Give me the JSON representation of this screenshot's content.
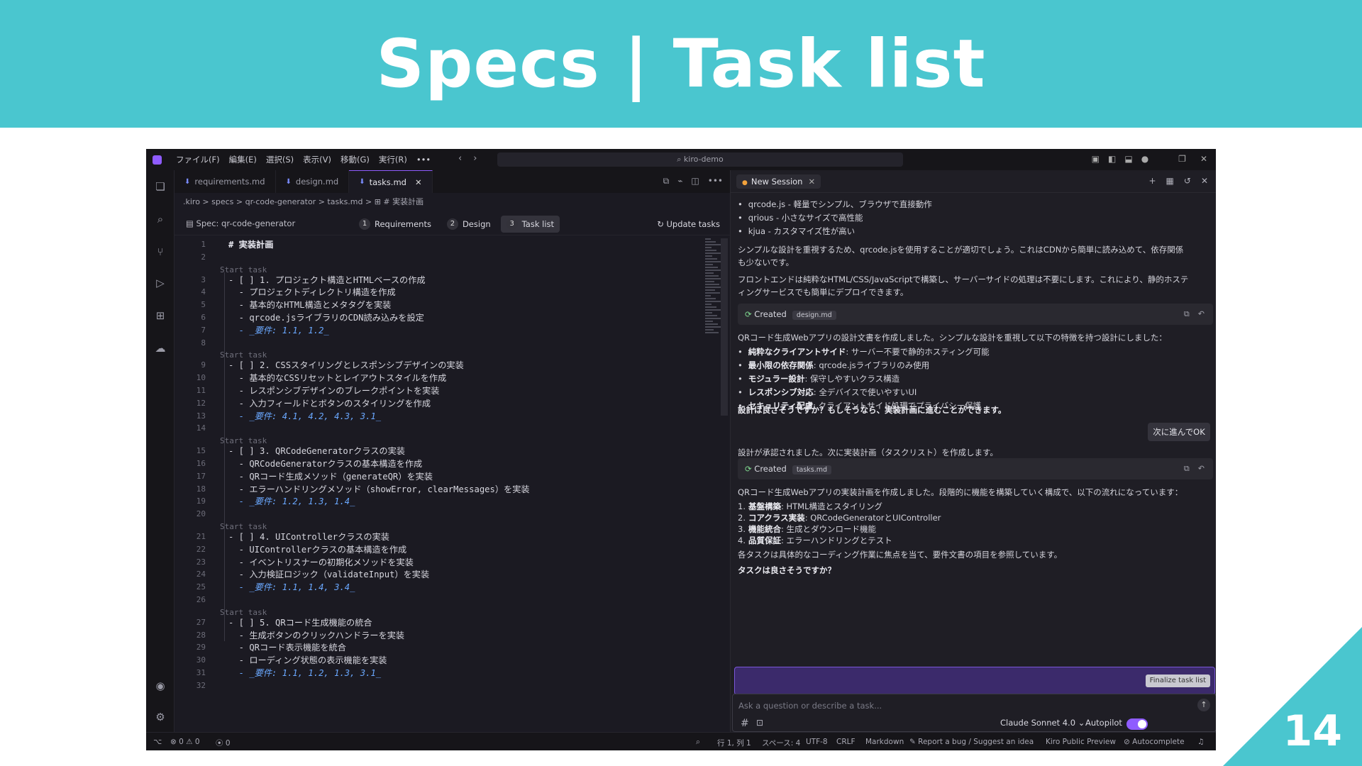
{
  "slide": {
    "title": "Specs | Task list",
    "page_number": "14",
    "accent_color": "#4ac6cf"
  },
  "titlebar": {
    "menu": [
      "ファイル(F)",
      "編集(E)",
      "選択(S)",
      "表示(V)",
      "移動(G)",
      "実行(R)",
      "•••"
    ],
    "search": "kiro-demo"
  },
  "tabs": [
    {
      "label": "requirements.md"
    },
    {
      "label": "design.md"
    },
    {
      "label": "tasks.md",
      "active": true
    }
  ],
  "breadcrumb": ".kiro > specs > qr-code-generator > tasks.md > ⊞ # 実装計画",
  "specbar": {
    "name": "Spec: qr-code-generator",
    "steps": [
      {
        "num": "1",
        "label": "Requirements"
      },
      {
        "num": "2",
        "label": "Design"
      },
      {
        "num": "3",
        "label": "Task list",
        "active": true
      }
    ],
    "update": "Update tasks"
  },
  "code": {
    "lens_label": "Start task",
    "lines": [
      {
        "n": "1",
        "t": "# 実装計画",
        "kind": "h1"
      },
      {
        "n": "2",
        "t": ""
      },
      {
        "n": "3",
        "t": "- [ ] 1. プロジェクト構造とHTMLベースの作成"
      },
      {
        "n": "4",
        "t": "  - プロジェクトディレクトリ構造を作成"
      },
      {
        "n": "5",
        "t": "  - 基本的なHTML構造とメタタグを実装"
      },
      {
        "n": "6",
        "t": "  - qrcode.jsライブラリのCDN読み込みを設定"
      },
      {
        "n": "7",
        "t": "  - _要件: 1.1, 1.2_",
        "kind": "req"
      },
      {
        "n": "8",
        "t": ""
      },
      {
        "n": "9",
        "t": "- [ ] 2. CSSスタイリングとレスポンシブデザインの実装"
      },
      {
        "n": "10",
        "t": "  - 基本的なCSSリセットとレイアウトスタイルを作成"
      },
      {
        "n": "11",
        "t": "  - レスポンシブデザインのブレークポイントを実装"
      },
      {
        "n": "12",
        "t": "  - 入力フィールドとボタンのスタイリングを作成"
      },
      {
        "n": "13",
        "t": "  - _要件: 4.1, 4.2, 4.3, 3.1_",
        "kind": "req"
      },
      {
        "n": "14",
        "t": ""
      },
      {
        "n": "15",
        "t": "- [ ] 3. QRCodeGeneratorクラスの実装"
      },
      {
        "n": "16",
        "t": "  - QRCodeGeneratorクラスの基本構造を作成"
      },
      {
        "n": "17",
        "t": "  - QRコード生成メソッド（generateQR）を実装"
      },
      {
        "n": "18",
        "t": "  - エラーハンドリングメソッド（showError, clearMessages）を実装"
      },
      {
        "n": "19",
        "t": "  - _要件: 1.2, 1.3, 1.4_",
        "kind": "req"
      },
      {
        "n": "20",
        "t": ""
      },
      {
        "n": "21",
        "t": "- [ ] 4. UIControllerクラスの実装"
      },
      {
        "n": "22",
        "t": "  - UIControllerクラスの基本構造を作成"
      },
      {
        "n": "23",
        "t": "  - イベントリスナーの初期化メソッドを実装"
      },
      {
        "n": "24",
        "t": "  - 入力検証ロジック（validateInput）を実装"
      },
      {
        "n": "25",
        "t": "  - _要件: 1.1, 1.4, 3.4_",
        "kind": "req"
      },
      {
        "n": "26",
        "t": ""
      },
      {
        "n": "27",
        "t": "- [ ] 5. QRコード生成機能の統合"
      },
      {
        "n": "28",
        "t": "  - 生成ボタンのクリックハンドラーを実装"
      },
      {
        "n": "29",
        "t": "  - QRコード表示機能を統合"
      },
      {
        "n": "30",
        "t": "  - ローディング状態の表示機能を実装"
      },
      {
        "n": "31",
        "t": "  - _要件: 1.1, 1.2, 1.3, 3.1_",
        "kind": "req"
      },
      {
        "n": "32",
        "t": ""
      }
    ]
  },
  "chat": {
    "session": "New Session",
    "lib_items": [
      "qrcode.js - 軽量でシンプル、ブラウザで直接動作",
      "qrious - 小さなサイズで高性能",
      "kjua - カスタマイズ性が高い"
    ],
    "para1_a": "シンプルな設計を重視するため、qrcode.jsを使用することが適切でしょう。これはCDNから簡単に読み込めて、依存関係",
    "para1_b": "も少ないです。",
    "para2_a": "フロントエンドは純粋なHTML/CSS/JavaScriptで構築し、サーバーサイドの処理は不要にします。これにより、静的ホステ",
    "para2_b": "ィングサービスでも簡単にデプロイできます。",
    "created_label": "Created",
    "created1_file": "design.md",
    "design_summary": "QRコード生成Webアプリの設計文書を作成しました。シンプルな設計を重視して以下の特徴を持つ設計にしました：",
    "design_features": [
      {
        "bold": "純粋なクライアントサイド",
        "rest": ": サーバー不要で静的ホスティング可能"
      },
      {
        "bold": "最小限の依存関係",
        "rest": ": qrcode.jsライブラリのみ使用"
      },
      {
        "bold": "モジュラー設計",
        "rest": ": 保守しやすいクラス構造"
      },
      {
        "bold": "レスポンシブ対応",
        "rest": ": 全デバイスで使いやすいUI"
      },
      {
        "bold": "セキュリティ配慮",
        "rest": ": クライアントサイド処理でプライバシー保護"
      }
    ],
    "design_question": "設計は良さそうですか？もしそうなら、実装計画に進むことができます。",
    "ok_button": "次に進んでOK",
    "approved": "設計が承認されました。次に実装計画（タスクリスト）を作成します。",
    "created2_file": "tasks.md",
    "tasks_summary": "QRコード生成Webアプリの実装計画を作成しました。段階的に機能を構築していく構成で、以下の流れになっています：",
    "tasks_steps": [
      {
        "num": "1.",
        "bold": "基盤構築",
        "rest": ": HTML構造とスタイリング"
      },
      {
        "num": "2.",
        "bold": "コアクラス実装",
        "rest": ": QRCodeGeneratorとUIController"
      },
      {
        "num": "3.",
        "bold": "機能統合",
        "rest": ": 生成とダウンロード機能"
      },
      {
        "num": "4.",
        "bold": "品質保証",
        "rest": ": エラーハンドリングとテスト"
      }
    ],
    "tasks_note": "各タスクは具体的なコーディング作業に焦点を当て、要件文書の項目を参照しています。",
    "tasks_question": "タスクは良さそうですか？",
    "finalize": "Finalize task list",
    "input_placeholder": "Ask a question or describe a task...",
    "model": "Claude Sonnet 4.0",
    "autopilot": "Autopilot"
  },
  "status": {
    "problems": "⊗ 0 ⚠ 0",
    "ports": "⦿ 0",
    "position": "行 1, 列 1",
    "spaces": "スペース: 4",
    "encoding": "UTF-8",
    "eol": "CRLF",
    "language": "Markdown",
    "report": "Report a bug / Suggest an idea",
    "preview": "Kiro Public Preview",
    "autocomplete": "Autocomplete"
  }
}
